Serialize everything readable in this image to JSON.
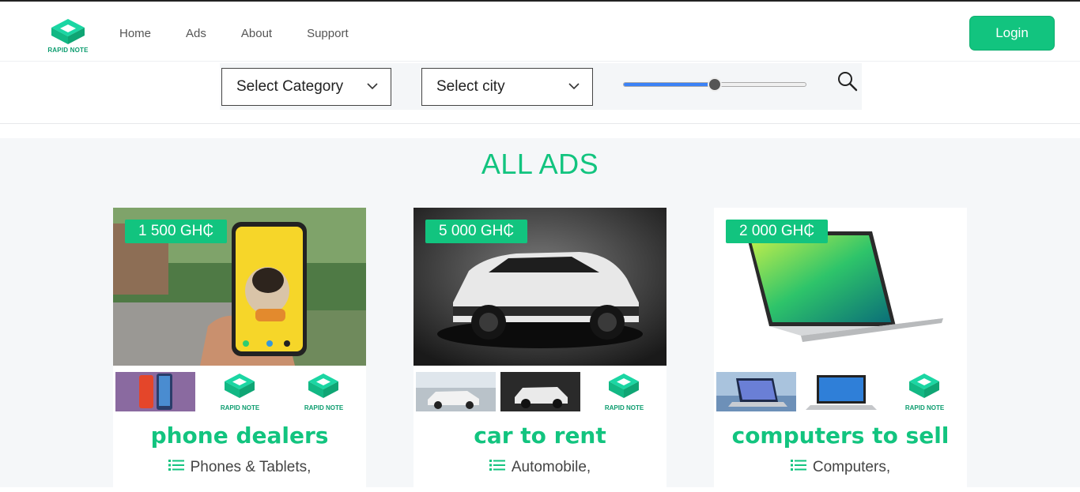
{
  "brand": {
    "logo_text": "RAPID NOTE",
    "accent": "#12c47f"
  },
  "nav": {
    "items": [
      "Home",
      "Ads",
      "About",
      "Support"
    ]
  },
  "header": {
    "login_label": "Login"
  },
  "filters": {
    "category_label": "Select Category",
    "city_label": "Select city",
    "price_slider_fraction": 0.5
  },
  "main": {
    "title": "ALL ADS"
  },
  "ads": [
    {
      "price": "1 500 GH₵",
      "title": "phone dealers",
      "category": "Phones & Tablets,"
    },
    {
      "price": "5 000 GH₵",
      "title": "car to rent",
      "category": "Automobile,"
    },
    {
      "price": "2 000 GH₵",
      "title": "computers to sell",
      "category": "Computers,"
    }
  ],
  "icons": {
    "logo": "rapid-note-logo-icon",
    "search": "search-icon",
    "dropdown": "chevron-down-icon",
    "category": "list-icon"
  }
}
